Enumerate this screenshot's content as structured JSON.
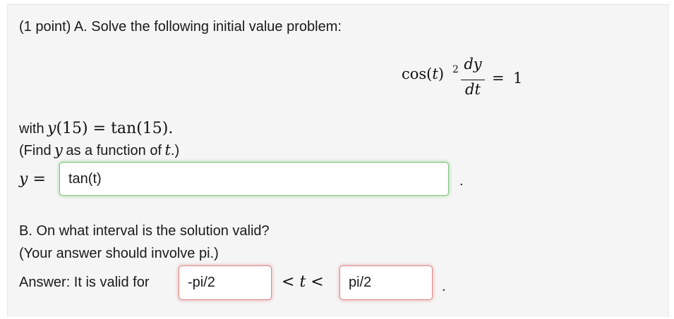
{
  "partA": {
    "header": "(1 point) A. Solve the following initial value problem:",
    "equation": {
      "lhs_func": "cos(",
      "lhs_var": "t",
      "lhs_close": ")",
      "exponent": "2",
      "numerator": "dy",
      "denominator": "dt",
      "equals": "=",
      "rhs": "1"
    },
    "condition_prefix": "with",
    "condition_y": "y",
    "condition_arg": "(15)",
    "condition_eq": "=",
    "condition_rhs": "tan(15)",
    "condition_period": ".",
    "find_open": "(Find",
    "find_var_y": "y",
    "find_mid": "as a function of",
    "find_var_t": "t",
    "find_close": ".)",
    "answer_label_y": "y",
    "answer_label_eq": "=",
    "answer_value": "tan(t)",
    "answer_period": "."
  },
  "partB": {
    "question": "B. On what interval is the solution valid?",
    "hint": "(Your answer should involve pi.)",
    "answer_label": "Answer: It is valid for",
    "lower_value": "-pi/2",
    "ineq_left": "<",
    "ineq_var": "t",
    "ineq_right": "<",
    "upper_value": "pi/2",
    "period": "."
  },
  "colors": {
    "correct_border": "#7dc47d",
    "incorrect_border": "#e08a8a",
    "panel_bg": "#f5f5f5"
  }
}
